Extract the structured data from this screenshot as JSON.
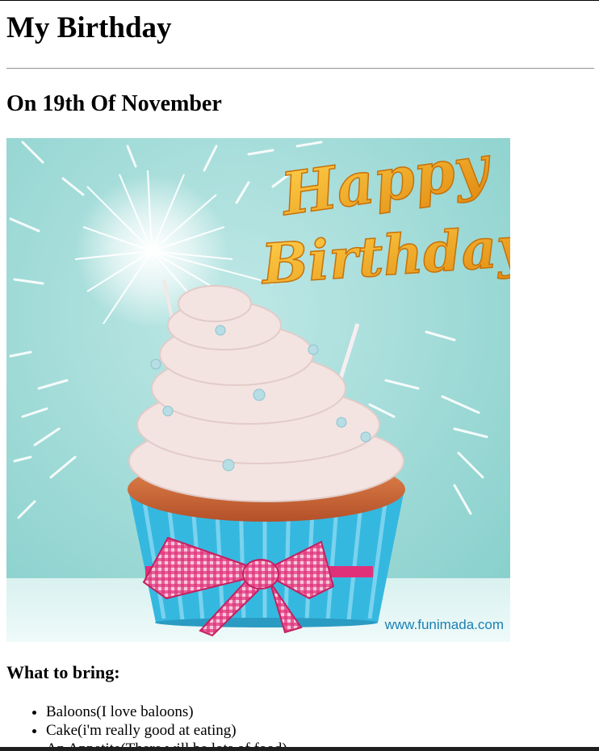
{
  "page": {
    "title": "My Birthday",
    "subtitle": "On 19th Of November"
  },
  "image": {
    "topper_text": "Happy Birthday",
    "watermark": "www.funimada.com",
    "colors": {
      "background": "#9fd9d6",
      "frosting": "#f3e4e2",
      "cake": "#c8642f",
      "wrapper": "#35b8e0",
      "ribbon": "#e0307a",
      "topper": "#f2a81f"
    }
  },
  "bring": {
    "heading": "What to bring:",
    "items": [
      "Baloons(I love baloons)",
      "Cake(i'm really good at eating)",
      "An Appetite(There will be lots of food)"
    ]
  }
}
